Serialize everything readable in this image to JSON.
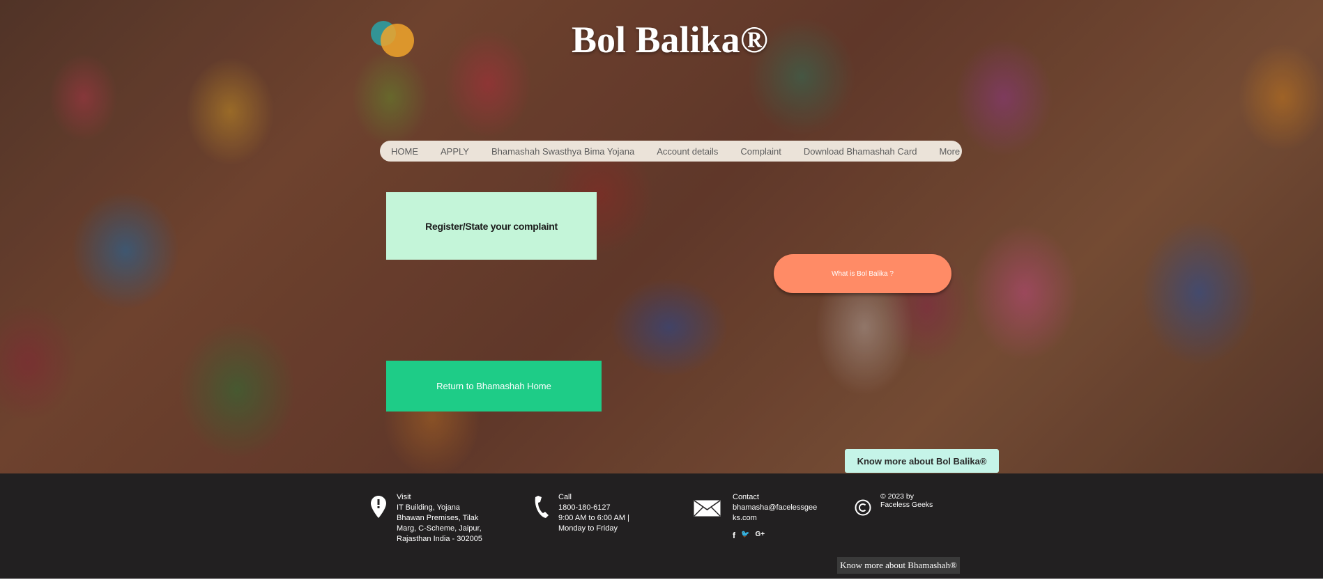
{
  "header": {
    "title": "Bol Balika®"
  },
  "nav": {
    "items": [
      {
        "label": "HOME"
      },
      {
        "label": "APPLY"
      },
      {
        "label": "Bhamashah Swasthya Bima Yojana"
      },
      {
        "label": "Account details"
      },
      {
        "label": "Complaint"
      },
      {
        "label": "Download Bhamashah Card"
      },
      {
        "label": "More"
      }
    ]
  },
  "main": {
    "complaint_label": "Register/State your complaint",
    "what_label": "What is Bol Balika ?",
    "return_label": "Return to Bhamashah Home",
    "know_balika_label": "Know more about Bol Balika®"
  },
  "footer": {
    "visit": {
      "title": "Visit",
      "lines": [
        "IT Building, Yojana",
        "Bhawan Premises, Tilak",
        "Marg, C-Scheme, Jaipur,",
        "Rajasthan India - 302005"
      ]
    },
    "call": {
      "title": "Call",
      "lines": [
        "1800-180-6127",
        "9:00 AM to 6:00 AM |",
        "Monday to Friday"
      ]
    },
    "contact": {
      "title": "Contact",
      "lines": [
        "bhamasha@facelessgee",
        "ks.com"
      ]
    },
    "copyright": {
      "lines": [
        "© 2023 by",
        "Faceless Geeks"
      ]
    },
    "social": {
      "facebook": "f",
      "twitter": "🐦",
      "googleplus": "G+"
    },
    "know_bhamashah_label": "Know more about Bhamashah®"
  },
  "colors": {
    "nav_bg": "#f5f0e6",
    "complaint_bg": "#c4f5d9",
    "what_bg": "#ff8b66",
    "return_bg": "#1ecc87",
    "know_bg": "#c5f4e8",
    "footer_bg": "#222021"
  }
}
